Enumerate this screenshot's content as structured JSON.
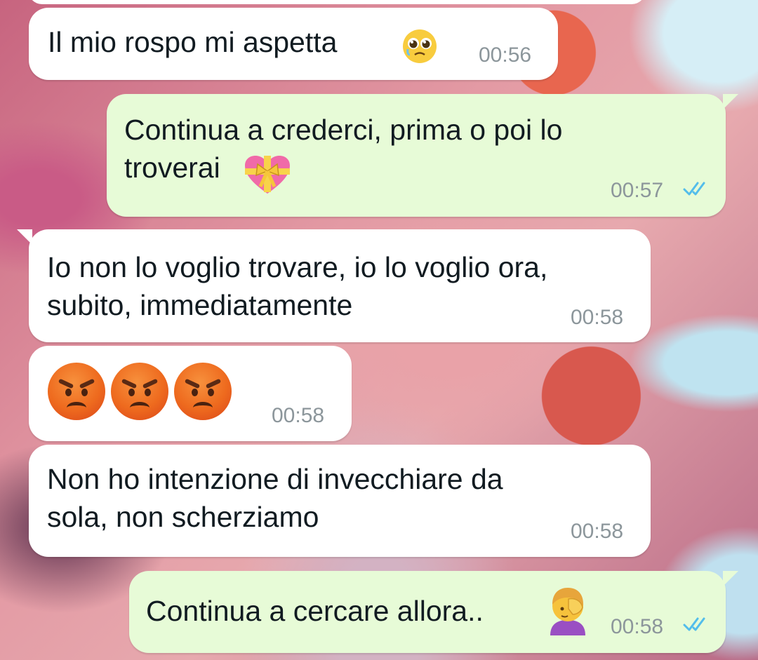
{
  "chat": {
    "messages": [
      {
        "direction": "incoming",
        "text": "Il mio rospo mi aspetta",
        "emoji": "pleading-face",
        "time": "00:56"
      },
      {
        "direction": "outgoing",
        "text": "Continua a crederci, prima o poi lo\ntroverai",
        "emoji": "heart-with-ribbon",
        "time": "00:57",
        "status": "read-double-check"
      },
      {
        "direction": "incoming",
        "text": "Io non lo voglio trovare, io lo voglio ora,\nsubito, immediatamente",
        "time": "00:58"
      },
      {
        "direction": "incoming",
        "emoji": "angry-face x3",
        "time": "00:58"
      },
      {
        "direction": "incoming",
        "text": "Non ho intenzione di invecchiare da\nsola, non scherziamo",
        "time": "00:58"
      },
      {
        "direction": "outgoing",
        "text": "Continua a cercare allora..",
        "emoji": "person-facepalming",
        "time": "00:58",
        "status": "read-double-check"
      }
    ]
  },
  "colors": {
    "incoming_bubble": "#ffffff",
    "outgoing_bubble": "#e7fbd7",
    "read_ticks": "#53bdeb",
    "timestamp": "#8c969b"
  }
}
